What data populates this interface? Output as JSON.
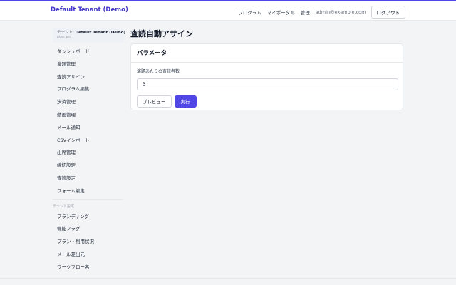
{
  "header": {
    "brand": "Default Tenant (Demo)",
    "nav": [
      "プログラム",
      "マイポータル",
      "管理"
    ],
    "user_email": "admin@example.com",
    "logout_label": "ログアウト"
  },
  "sidebar": {
    "tenant_prefix": "テナント: ",
    "tenant_name": "Default Tenant (Demo)",
    "tenant_plan": "plan: pro",
    "items": [
      "ダッシュボード",
      "演題管理",
      "査読アサイン",
      "プログラム編集",
      "決済管理",
      "動画管理",
      "メール通知",
      "CSVインポート",
      "出席管理",
      "締切設定",
      "査読設定",
      "フォーム編集"
    ],
    "section_label": "テナント設定",
    "settings_items": [
      "ブランディング",
      "機能フラグ",
      "プラン・利用状況",
      "メール差出元",
      "ワークフロー名"
    ]
  },
  "main": {
    "title": "査読自動アサイン",
    "card_title": "パラメータ",
    "field_label": "演題あたりの査読者数",
    "field_value": "3",
    "preview_label": "プレビュー",
    "run_label": "実行"
  }
}
